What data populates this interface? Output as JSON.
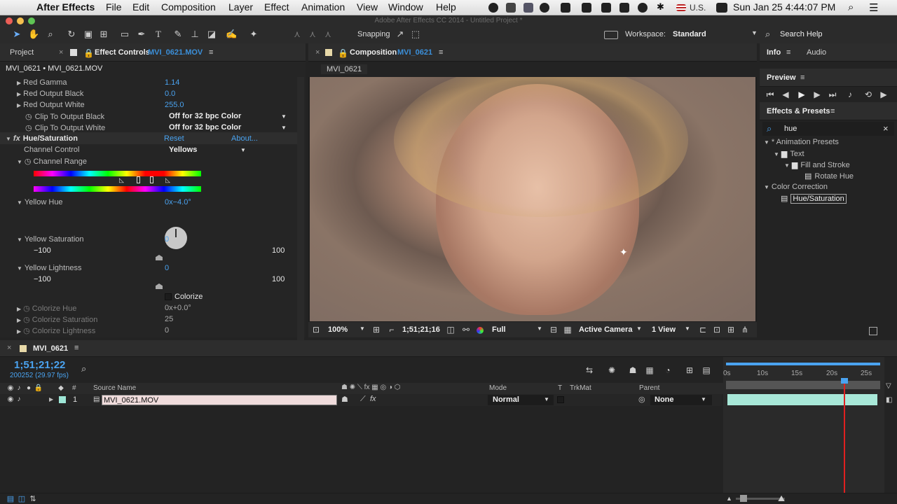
{
  "menubar": {
    "apple": "",
    "app": "After Effects",
    "items": [
      "File",
      "Edit",
      "Composition",
      "Layer",
      "Effect",
      "Animation",
      "View",
      "Window",
      "Help"
    ],
    "input_source": "U.S.",
    "datetime": "Sun Jan 25  4:44:07 PM"
  },
  "window_title": "Adobe After Effects CC 2014 - Untitled Project *",
  "toolbar": {
    "snapping_label": "Snapping",
    "workspace_label": "Workspace:",
    "workspace_value": "Standard",
    "search_help": "Search Help"
  },
  "left_panel": {
    "tab_project": "Project",
    "tab_effect_controls": "Effect Controls",
    "effect_file": "MVI_0621.MOV",
    "breadcrumb": "MVI_0621 • MVI_0621.MOV",
    "props": {
      "red_gamma": {
        "label": "Red Gamma",
        "value": "1.14"
      },
      "red_out_black": {
        "label": "Red Output Black",
        "value": "0.0"
      },
      "red_out_white": {
        "label": "Red Output White",
        "value": "255.0"
      },
      "clip_black": {
        "label": "Clip To Output Black",
        "value": "Off for 32 bpc Color"
      },
      "clip_white": {
        "label": "Clip To Output White",
        "value": "Off for 32 bpc Color"
      },
      "hue_sat": {
        "label": "Hue/Saturation",
        "reset": "Reset",
        "about": "About..."
      },
      "channel_control": {
        "label": "Channel Control",
        "value": "Yellows"
      },
      "channel_range": {
        "label": "Channel Range"
      },
      "yellow_hue": {
        "label": "Yellow Hue",
        "value": "0x−4.0°"
      },
      "yellow_sat": {
        "label": "Yellow Saturation",
        "value": "0",
        "min": "−100",
        "max": "100"
      },
      "yellow_light": {
        "label": "Yellow Lightness",
        "value": "0",
        "min": "−100",
        "max": "100"
      },
      "colorize": {
        "label": "Colorize"
      },
      "colorize_hue": {
        "label": "Colorize Hue",
        "value": "0x+0.0°"
      },
      "colorize_sat": {
        "label": "Colorize Saturation",
        "value": "25"
      },
      "colorize_light": {
        "label": "Colorize Lightness",
        "value": "0"
      }
    }
  },
  "comp_panel": {
    "tab_label": "Composition",
    "comp_name": "MVI_0621",
    "sub_tab": "MVI_0621",
    "zoom": "100%",
    "timecode": "1;51;21;16",
    "resolution": "Full",
    "camera": "Active Camera",
    "views": "1 View"
  },
  "right_panel": {
    "tab_info": "Info",
    "tab_audio": "Audio",
    "tab_preview": "Preview",
    "tab_effects": "Effects & Presets",
    "search_value": "hue",
    "tree": {
      "animation_presets": "* Animation Presets",
      "text": "Text",
      "fill_stroke": "Fill and Stroke",
      "rotate_hue": "Rotate Hue",
      "color_correction": "Color Correction",
      "hue_saturation": "Hue/Saturation"
    }
  },
  "timeline": {
    "tab_label": "MVI_0621",
    "timecode": "1;51;21;22",
    "frame_info": "200252 (29.97 fps)",
    "columns": {
      "source_name": "Source Name",
      "mode": "Mode",
      "t": "T",
      "trkmat": "TrkMat",
      "parent": "Parent",
      "hash": "#"
    },
    "ruler": [
      "0s",
      "10s",
      "15s",
      "20s",
      "25s"
    ],
    "layers": [
      {
        "index": "1",
        "name": "MVI_0621.MOV",
        "mode": "Normal",
        "parent": "None"
      }
    ]
  }
}
